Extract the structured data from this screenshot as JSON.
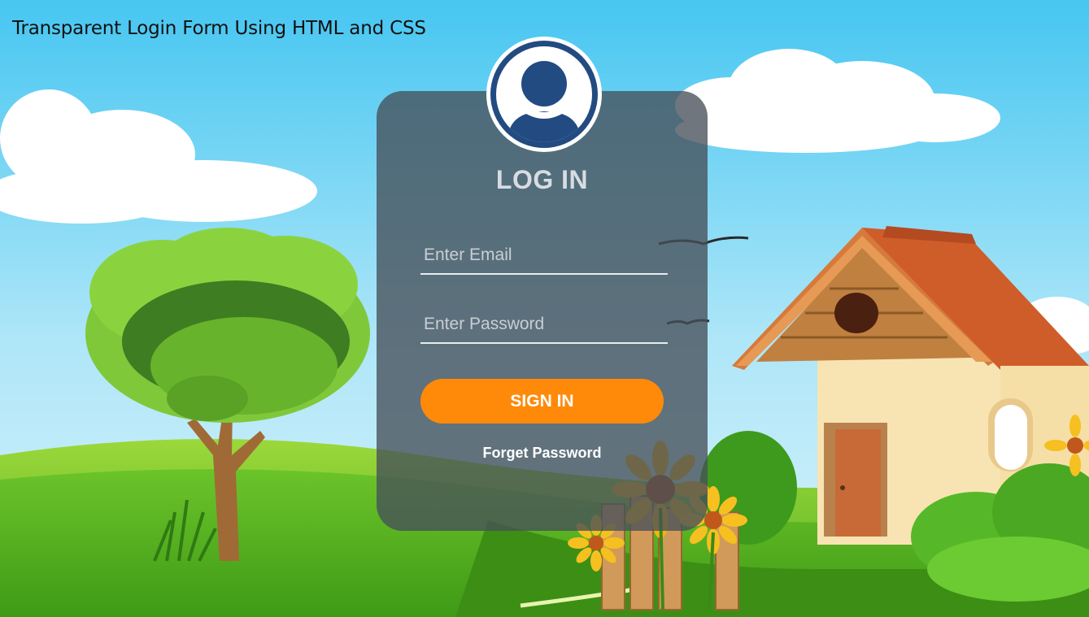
{
  "page_title": "Transparent Login Form Using HTML and CSS",
  "login": {
    "title": "LOG IN",
    "email_placeholder": "Enter Email",
    "password_placeholder": "Enter Password",
    "signin_label": "SIGN IN",
    "forgot_label": "Forget Password"
  },
  "colors": {
    "sky_top": "#4fc9f2",
    "grass": "#5cb82a",
    "card_overlay": "#46505a",
    "accent_orange": "#ff8a0a",
    "avatar_blue": "#224b82"
  },
  "icons": [
    "user-avatar-icon"
  ]
}
